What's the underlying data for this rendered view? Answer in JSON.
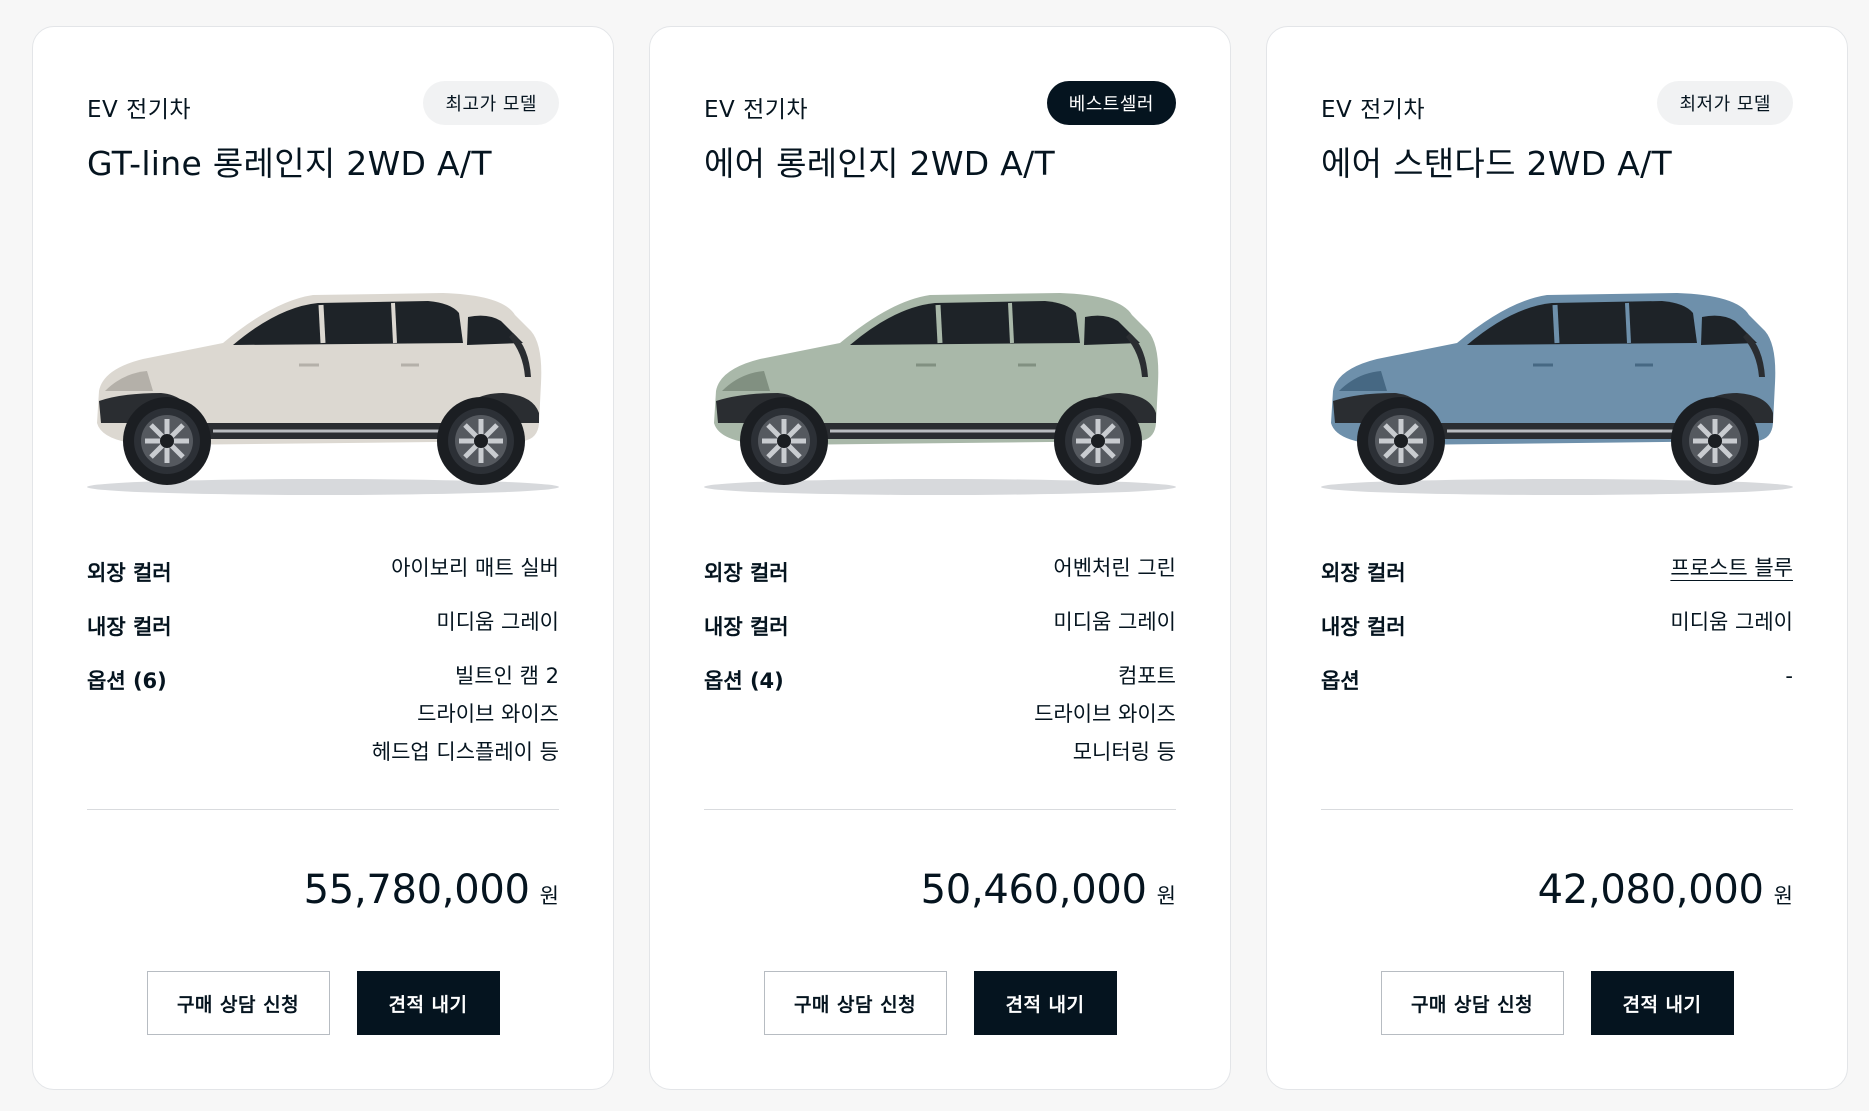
{
  "cards": [
    {
      "category": "EV 전기차",
      "badge": "최고가 모델",
      "badge_style": "light",
      "model": "GT-line 롱레인지 2WD A/T",
      "car_image": "white-suv-side-view",
      "car_color": "#dcd8d1",
      "exterior_label": "외장 컬러",
      "exterior_value": "아이보리 매트 실버",
      "interior_label": "내장 컬러",
      "interior_value": "미디움 그레이",
      "options_label": "옵션 (6)",
      "options": [
        "빌트인 캠 2",
        "드라이브 와이즈",
        "헤드업 디스플레이 등"
      ],
      "price": "55,780,000",
      "price_unit": "원",
      "consult_button": "구매 상담 신청",
      "quote_button": "견적 내기"
    },
    {
      "category": "EV 전기차",
      "badge": "베스트셀러",
      "badge_style": "dark",
      "model": "에어 롱레인지 2WD A/T",
      "car_image": "green-suv-side-view",
      "car_color": "#a9b8a9",
      "exterior_label": "외장 컬러",
      "exterior_value": "어벤처린 그린",
      "interior_label": "내장 컬러",
      "interior_value": "미디움 그레이",
      "options_label": "옵션 (4)",
      "options": [
        "컴포트",
        "드라이브 와이즈",
        "모니터링 등"
      ],
      "price": "50,460,000",
      "price_unit": "원",
      "consult_button": "구매 상담 신청",
      "quote_button": "견적 내기"
    },
    {
      "category": "EV 전기차",
      "badge": "최저가 모델",
      "badge_style": "light",
      "model": "에어 스탠다드 2WD A/T",
      "car_image": "blue-suv-side-view",
      "car_color": "#6e90ab",
      "exterior_label": "외장 컬러",
      "exterior_value": "프로스트 블루",
      "interior_label": "내장 컬러",
      "interior_value": "미디움 그레이",
      "options_label": "옵션",
      "options": [
        "-"
      ],
      "price": "42,080,000",
      "price_unit": "원",
      "consult_button": "구매 상담 신청",
      "quote_button": "견적 내기"
    }
  ],
  "colors": {
    "text": "#05141f",
    "dark_button": "#05141f",
    "card_bg": "#ffffff",
    "page_bg": "#f7f7f7"
  }
}
